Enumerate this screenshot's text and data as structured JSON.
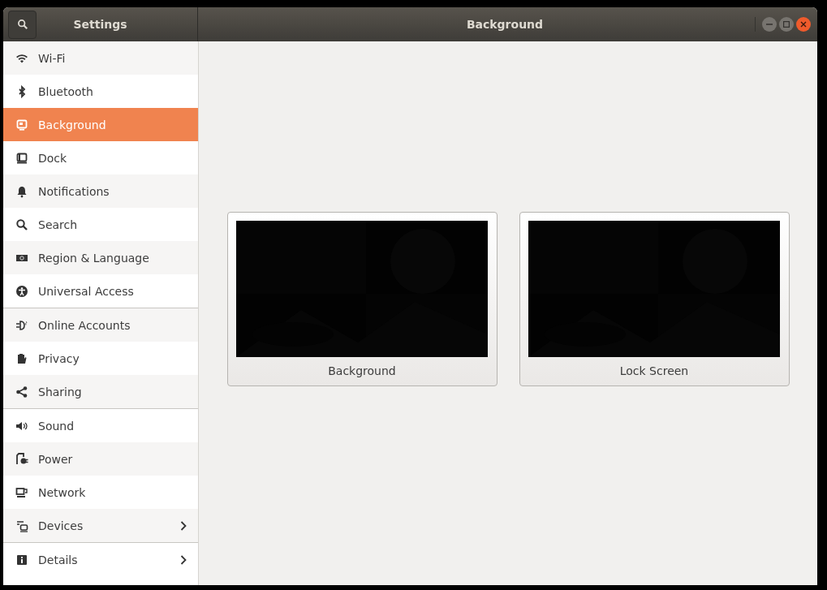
{
  "sidebar": {
    "title": "Settings",
    "groups": [
      [
        {
          "label": "Wi-Fi",
          "selected": false,
          "expandable": false
        },
        {
          "label": "Bluetooth",
          "selected": false,
          "expandable": false
        },
        {
          "label": "Background",
          "selected": true,
          "expandable": false
        },
        {
          "label": "Dock",
          "selected": false,
          "expandable": false
        },
        {
          "label": "Notifications",
          "selected": false,
          "expandable": false
        },
        {
          "label": "Search",
          "selected": false,
          "expandable": false
        },
        {
          "label": "Region & Language",
          "selected": false,
          "expandable": false
        },
        {
          "label": "Universal Access",
          "selected": false,
          "expandable": false
        }
      ],
      [
        {
          "label": "Online Accounts",
          "selected": false,
          "expandable": false
        },
        {
          "label": "Privacy",
          "selected": false,
          "expandable": false
        },
        {
          "label": "Sharing",
          "selected": false,
          "expandable": false
        }
      ],
      [
        {
          "label": "Sound",
          "selected": false,
          "expandable": false
        },
        {
          "label": "Power",
          "selected": false,
          "expandable": false
        },
        {
          "label": "Network",
          "selected": false,
          "expandable": false
        },
        {
          "label": "Devices",
          "selected": false,
          "expandable": true
        }
      ],
      [
        {
          "label": "Details",
          "selected": false,
          "expandable": true
        }
      ]
    ]
  },
  "window": {
    "title": "Background"
  },
  "wallpapers": [
    {
      "label": "Background",
      "kind": "picture"
    },
    {
      "label": "Lock Screen",
      "kind": "picture"
    }
  ]
}
